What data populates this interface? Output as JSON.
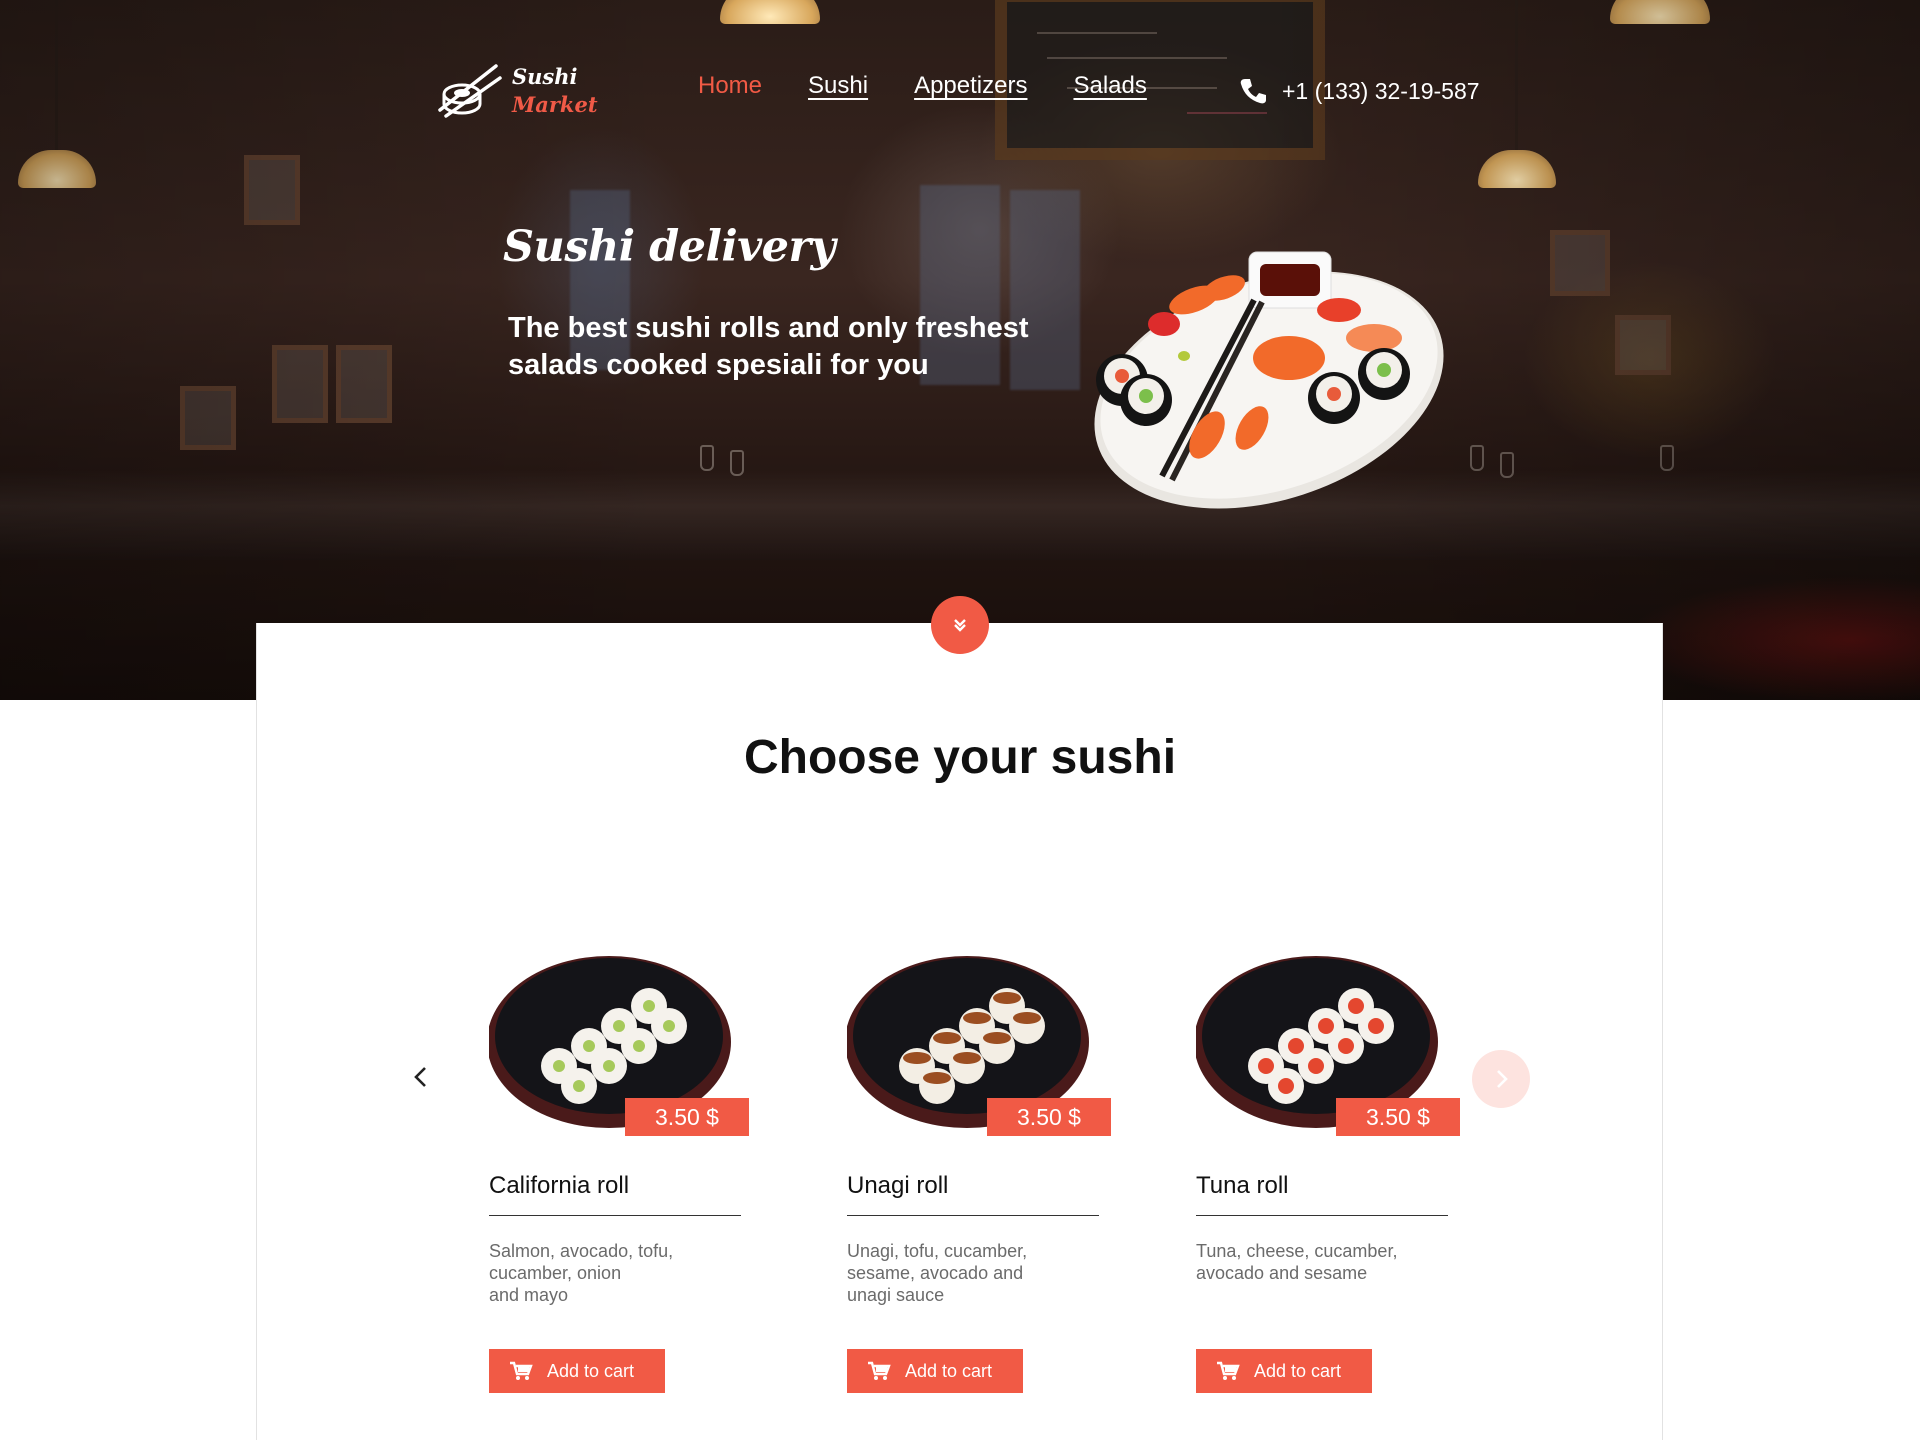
{
  "brand": {
    "line1": "Sushi",
    "line2": "Market",
    "accent": "#f15a45"
  },
  "nav": {
    "items": [
      {
        "label": "Home",
        "active": true
      },
      {
        "label": "Sushi",
        "active": false
      },
      {
        "label": "Appetizers",
        "active": false
      },
      {
        "label": "Salads",
        "active": false
      }
    ]
  },
  "contact": {
    "phone": "+1 (133) 32-19-587",
    "icon": "phone-icon"
  },
  "hero": {
    "title": "Sushi delivery",
    "subtitle": "The best sushi rolls and only freshest salads cooked spesiali for you"
  },
  "scroll_button": {
    "icon": "chevron-double-down-icon"
  },
  "section": {
    "title": "Choose your sushi"
  },
  "carousel": {
    "prev_icon": "chevron-left-icon",
    "next_icon": "chevron-right-icon"
  },
  "products": [
    {
      "name": "California roll",
      "price": "3.50 $",
      "description": "Salmon, avocado, tofu,\ncucamber, onion\nand mayo",
      "button": "Add to cart"
    },
    {
      "name": "Unagi roll",
      "price": "3.50 $",
      "description": "Unagi, tofu, cucamber,\nsesame, avocado and\nunagi sauce",
      "button": "Add to cart"
    },
    {
      "name": "Tuna roll",
      "price": "3.50 $",
      "description": "Tuna, cheese, cucamber,\navocado and sesame",
      "button": "Add to cart"
    }
  ]
}
